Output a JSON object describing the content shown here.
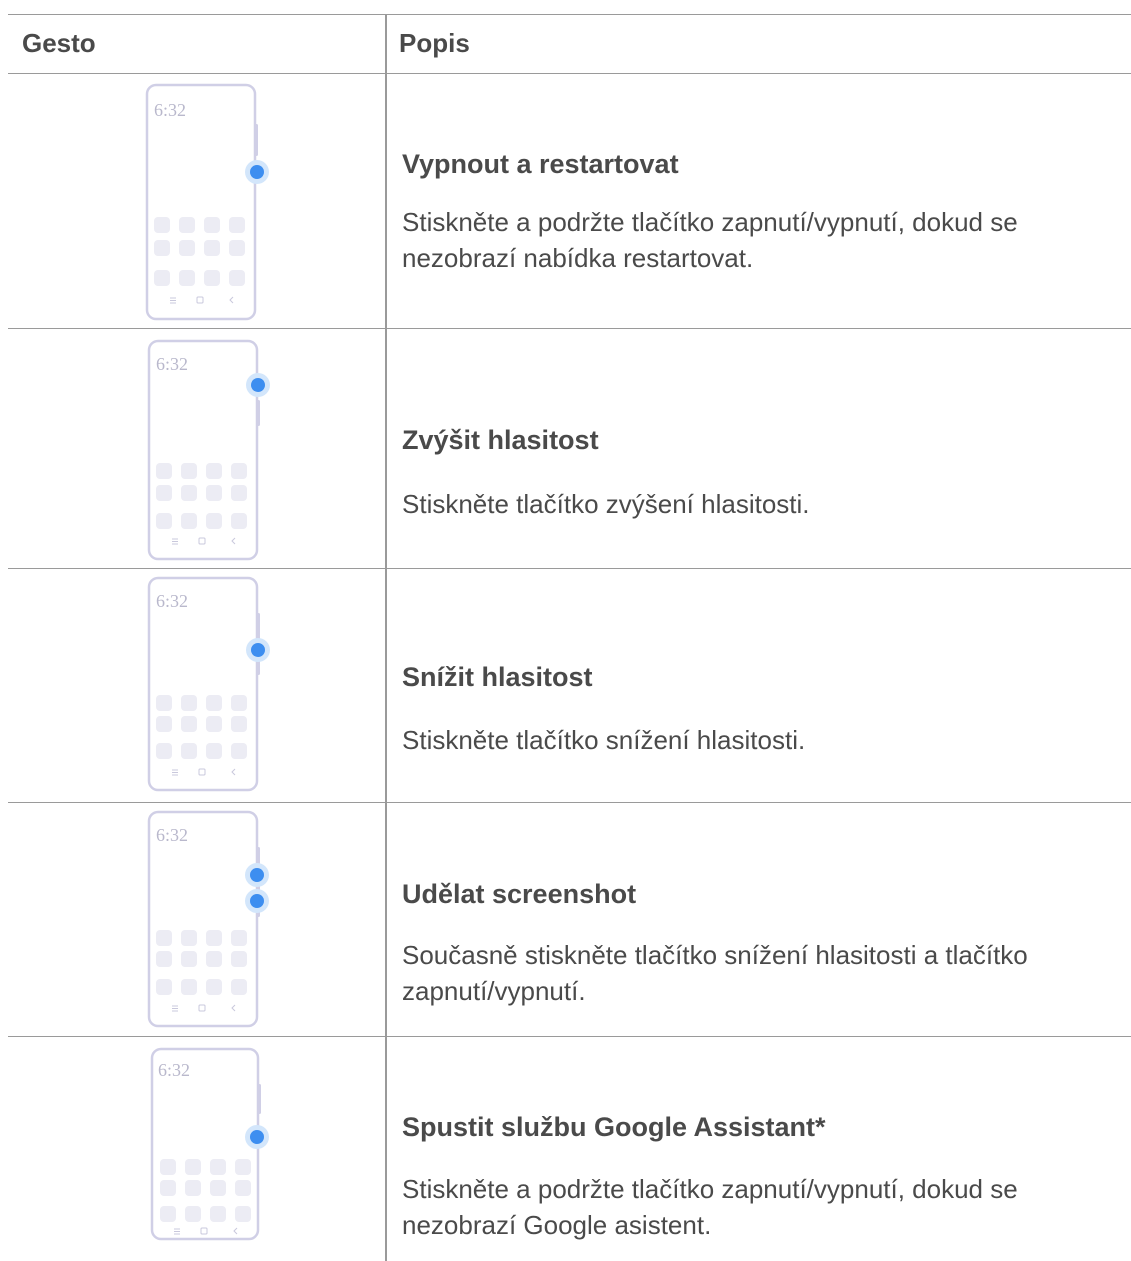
{
  "table": {
    "headers": {
      "gesture": "Gesto",
      "description": "Popis"
    },
    "phone_time": "6:32",
    "rows": [
      {
        "title": "Vypnout a restartovat",
        "description": "Stiskněte a podržte tlačítko zapnutí/vypnutí, dokud se nezobrazí nabídka restartovat."
      },
      {
        "title": "Zvýšit hlasitost",
        "description": "Stiskněte tlačítko zvýšení hlasitosti."
      },
      {
        "title": "Snížit hlasitost",
        "description": "Stiskněte tlačítko snížení hlasitosti."
      },
      {
        "title": "Udělat screenshot",
        "description": "Současně stiskněte tlačítko snížení hlasitosti a tlačítko zapnutí/vypnutí."
      },
      {
        "title": "Spustit službu Google Assistant*",
        "description": "Stiskněte a podržte tlačítko zapnutí/vypnutí, dokud se nezobrazí Google asistent."
      }
    ]
  },
  "colors": {
    "text": "#4a4a4a",
    "rule": "#9a9a9a",
    "phone_outline": "#d0cfe6",
    "app_tile": "#ececf4",
    "press_dot": "#3d8ef0",
    "press_halo": "#d3e6fb"
  }
}
